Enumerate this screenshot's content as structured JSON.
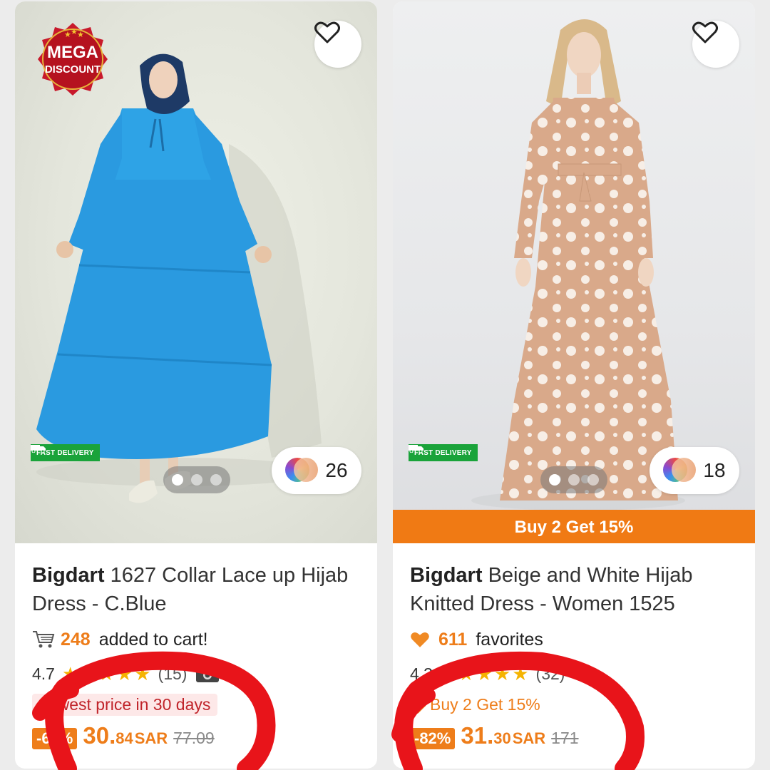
{
  "products": [
    {
      "brand": "Bigdart",
      "title": "1627 Collar Lace up Hijab Dress - C.Blue",
      "badge_text_1": "MEGA",
      "badge_text_2": "DISCOUNT",
      "fast_delivery": "FAST DELIVERY",
      "color_count": "26",
      "social_count": "248",
      "social_text": "added to cart!",
      "social_icon": "cart-icon",
      "rating": "4.7",
      "rating_count": "(15)",
      "tag": "Lowest price in 30 days",
      "discount": "-60%",
      "price_int": "30.",
      "price_dec": "84",
      "currency": "SAR",
      "old_price": "77.09",
      "images_total": 3,
      "active_image": 1
    },
    {
      "brand": "Bigdart",
      "title": "Beige and White Hijab Knitted Dress - Women 1525",
      "fast_delivery": "FAST DELIVERY",
      "color_count": "18",
      "promo_bar": "Buy 2 Get 15%",
      "social_count": "611",
      "social_text": "favorites",
      "social_icon": "heart-icon",
      "rating": "4.3",
      "rating_count": "(32)",
      "tag": "Buy 2 Get 15%",
      "discount": "-82%",
      "price_int": "31.",
      "price_dec": "30",
      "currency": "SAR",
      "old_price": "171",
      "images_total": 3,
      "active_image": 1
    }
  ],
  "colors": {
    "accent_orange": "#ee7d1a",
    "promo_bar": "#f07a14",
    "fast_delivery_green": "#1aa33a",
    "annotation_red": "#e8141a",
    "star": "#f5b301"
  }
}
